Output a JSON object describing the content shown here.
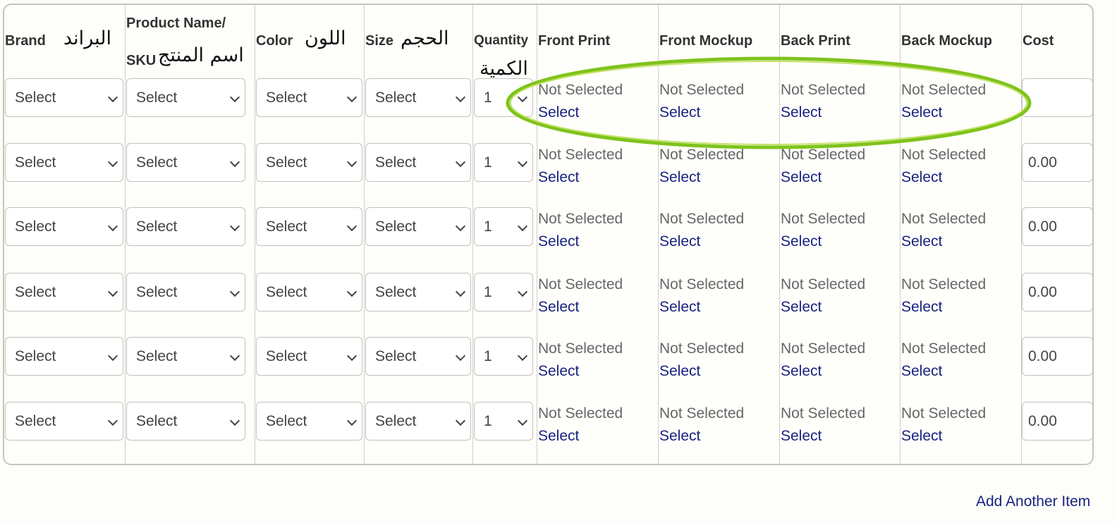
{
  "headers": {
    "brand_en": "Brand",
    "brand_ar": "البراند",
    "product_en_1": "Product Name/",
    "product_en_2": "SKU",
    "product_ar": "اسم المنتج",
    "color_en": "Color",
    "color_ar": "اللون",
    "size_en": "Size",
    "size_ar": "الحجم",
    "quantity_en": "Quantity",
    "quantity_ar": "الكمية",
    "front_print": "Front Print",
    "front_mockup": "Front Mockup",
    "back_print": "Back Print",
    "back_mockup": "Back Mockup",
    "cost": "Cost"
  },
  "rows": [
    {
      "brand": "Select",
      "product": "Select",
      "color": "Select",
      "size": "Select",
      "quantity": "1",
      "front_print": {
        "status": "Not Selected",
        "link": "Select"
      },
      "front_mockup": {
        "status": "Not Selected",
        "link": "Select"
      },
      "back_print": {
        "status": "Not Selected",
        "link": "Select"
      },
      "back_mockup": {
        "status": "Not Selected",
        "link": "Select"
      },
      "cost": ""
    },
    {
      "brand": "Select",
      "product": "Select",
      "color": "Select",
      "size": "Select",
      "quantity": "1",
      "front_print": {
        "status": "Not Selected",
        "link": "Select"
      },
      "front_mockup": {
        "status": "Not Selected",
        "link": "Select"
      },
      "back_print": {
        "status": "Not Selected",
        "link": "Select"
      },
      "back_mockup": {
        "status": "Not Selected",
        "link": "Select"
      },
      "cost": "0.00"
    },
    {
      "brand": "Select",
      "product": "Select",
      "color": "Select",
      "size": "Select",
      "quantity": "1",
      "front_print": {
        "status": "Not Selected",
        "link": "Select"
      },
      "front_mockup": {
        "status": "Not Selected",
        "link": "Select"
      },
      "back_print": {
        "status": "Not Selected",
        "link": "Select"
      },
      "back_mockup": {
        "status": "Not Selected",
        "link": "Select"
      },
      "cost": "0.00"
    },
    {
      "brand": "Select",
      "product": "Select",
      "color": "Select",
      "size": "Select",
      "quantity": "1",
      "front_print": {
        "status": "Not Selected",
        "link": "Select"
      },
      "front_mockup": {
        "status": "Not Selected",
        "link": "Select"
      },
      "back_print": {
        "status": "Not Selected",
        "link": "Select"
      },
      "back_mockup": {
        "status": "Not Selected",
        "link": "Select"
      },
      "cost": "0.00"
    },
    {
      "brand": "Select",
      "product": "Select",
      "color": "Select",
      "size": "Select",
      "quantity": "1",
      "front_print": {
        "status": "Not Selected",
        "link": "Select"
      },
      "front_mockup": {
        "status": "Not Selected",
        "link": "Select"
      },
      "back_print": {
        "status": "Not Selected",
        "link": "Select"
      },
      "back_mockup": {
        "status": "Not Selected",
        "link": "Select"
      },
      "cost": "0.00"
    },
    {
      "brand": "Select",
      "product": "Select",
      "color": "Select",
      "size": "Select",
      "quantity": "1",
      "front_print": {
        "status": "Not Selected",
        "link": "Select"
      },
      "front_mockup": {
        "status": "Not Selected",
        "link": "Select"
      },
      "back_print": {
        "status": "Not Selected",
        "link": "Select"
      },
      "back_mockup": {
        "status": "Not Selected",
        "link": "Select"
      },
      "cost": "0.00"
    }
  ],
  "footer": {
    "add_item": "Add Another Item"
  },
  "colors": {
    "link": "#1a237e",
    "border": "#c8c4bd",
    "annotation": "#7fc31c"
  }
}
